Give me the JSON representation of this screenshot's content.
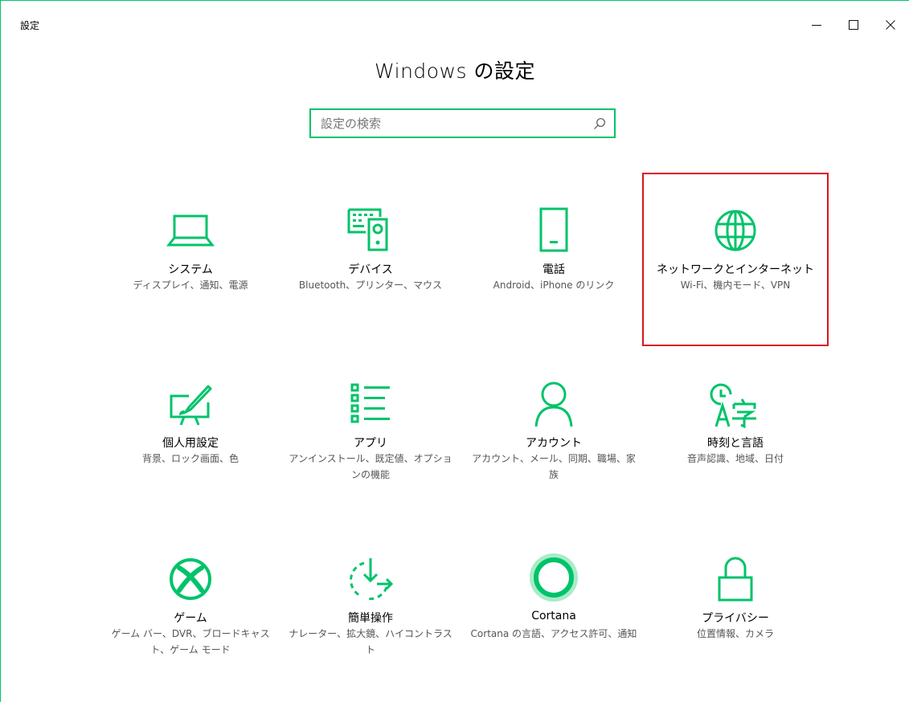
{
  "window": {
    "title": "設定",
    "controls": {
      "minimize": "—",
      "maximize": "☐",
      "close": "✕"
    }
  },
  "heading": "Windows の設定",
  "search": {
    "placeholder": "設定の検索",
    "value": ""
  },
  "accent_color": "#00c36a",
  "highlight_color": "#d9141c",
  "tiles": [
    {
      "id": "system",
      "icon": "laptop-icon",
      "title": "システム",
      "desc": "ディスプレイ、通知、電源"
    },
    {
      "id": "devices",
      "icon": "keyboard-speaker-icon",
      "title": "デバイス",
      "desc": "Bluetooth、プリンター、マウス"
    },
    {
      "id": "phone",
      "icon": "phone-icon",
      "title": "電話",
      "desc": "Android、iPhone のリンク"
    },
    {
      "id": "network",
      "icon": "globe-icon",
      "title": "ネットワークとインターネット",
      "desc": "Wi-Fi、機内モード、VPN"
    },
    {
      "id": "personalization",
      "icon": "paint-icon",
      "title": "個人用設定",
      "desc": "背景、ロック画面、色"
    },
    {
      "id": "apps",
      "icon": "apps-list-icon",
      "title": "アプリ",
      "desc": "アンインストール、既定値、オプションの機能"
    },
    {
      "id": "accounts",
      "icon": "person-icon",
      "title": "アカウント",
      "desc": "アカウント、メール、同期、職場、家族"
    },
    {
      "id": "time-language",
      "icon": "time-language-icon",
      "title": "時刻と言語",
      "desc": "音声認識、地域、日付"
    },
    {
      "id": "gaming",
      "icon": "xbox-icon",
      "title": "ゲーム",
      "desc": "ゲーム バー、DVR、ブロードキャスト、ゲーム モード"
    },
    {
      "id": "ease-of-access",
      "icon": "ease-of-access-icon",
      "title": "簡単操作",
      "desc": "ナレーター、拡大鏡、ハイコントラスト"
    },
    {
      "id": "cortana",
      "icon": "cortana-icon",
      "title": "Cortana",
      "desc": "Cortana の言語、アクセス許可、通知"
    },
    {
      "id": "privacy",
      "icon": "lock-icon",
      "title": "プライバシー",
      "desc": "位置情報、カメラ"
    }
  ]
}
